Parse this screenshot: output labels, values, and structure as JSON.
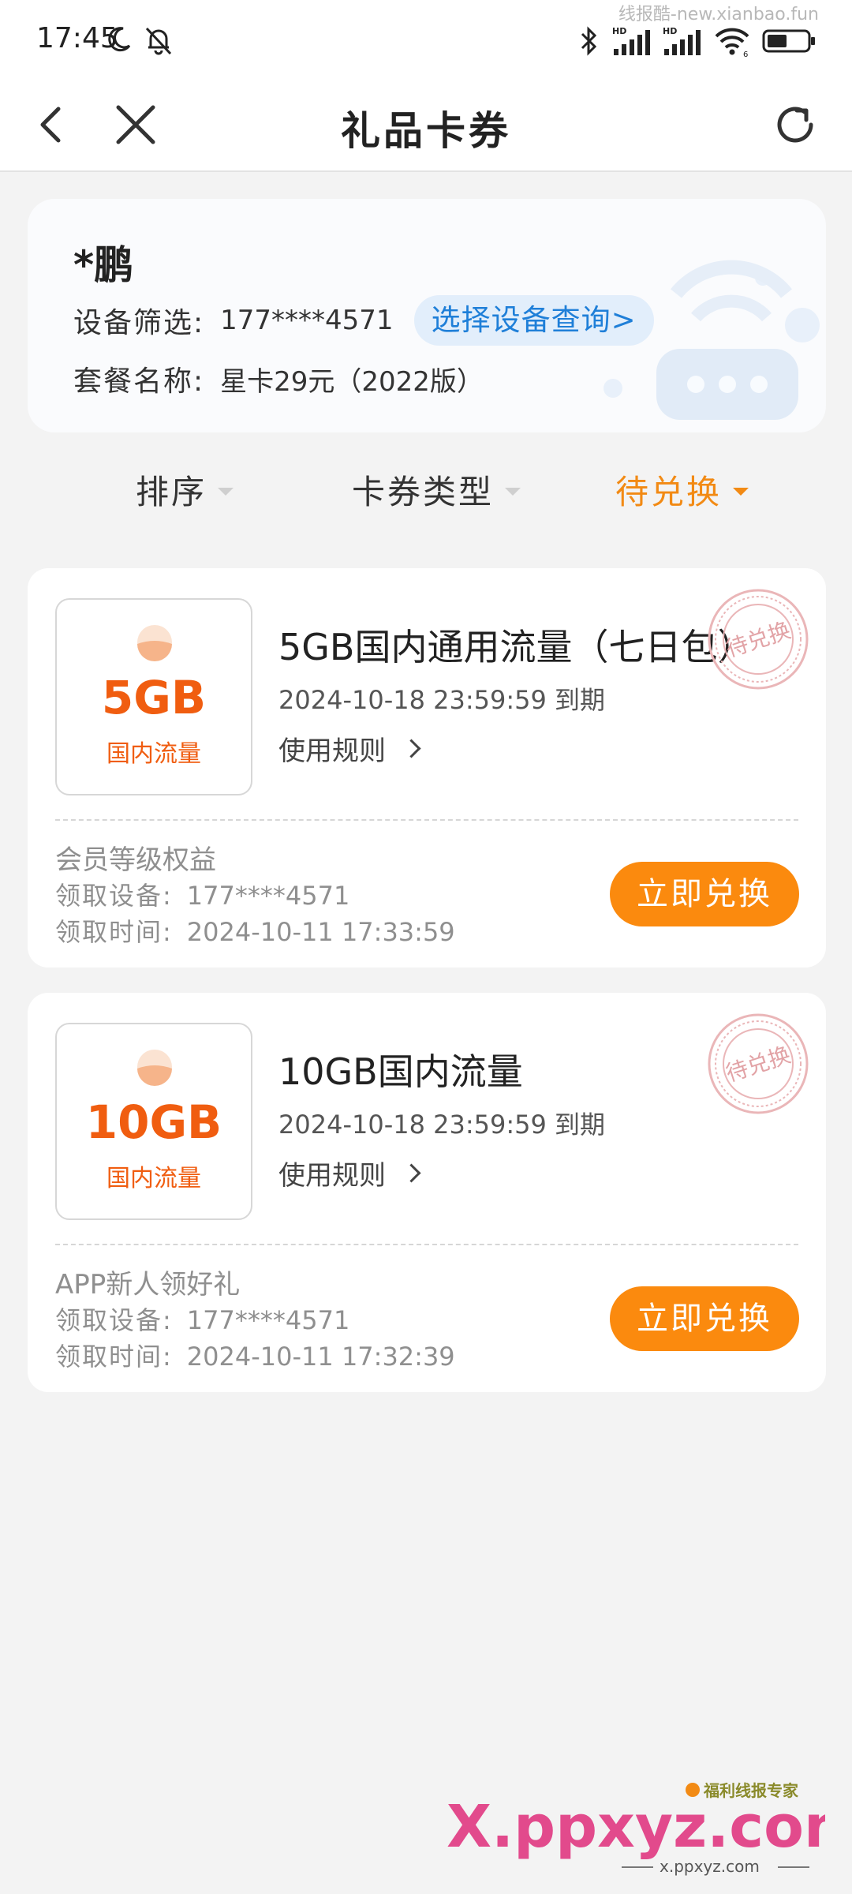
{
  "status_bar": {
    "time": "17:45",
    "watermark": "线报酷-new.xianbao.fun",
    "network_labels": [
      "HD",
      "HD"
    ],
    "wifi_badge": "6"
  },
  "nav": {
    "title": "礼品卡券"
  },
  "device_card": {
    "user_name": "*鹏",
    "device_label": "设备筛选:",
    "device_value": "177****4571",
    "select_button": "选择设备查询>",
    "plan_label": "套餐名称:",
    "plan_value": "星卡29元（2022版）"
  },
  "filters": [
    {
      "label": "排序",
      "active": false
    },
    {
      "label": "卡券类型",
      "active": false
    },
    {
      "label": "待兑换",
      "active": true
    }
  ],
  "coupons": [
    {
      "thumb_amount": "5GB",
      "thumb_sub": "国内流量",
      "title": "5GB国内通用流量（七日包）",
      "expire": "2024-10-18 23:59:59 到期",
      "rules": "使用规则",
      "stamp": "待兑换",
      "source": "会员等级权益",
      "device_key": "领取设备:",
      "device_value": "177****4571",
      "time_key": "领取时间:",
      "time_value": "2024-10-11 17:33:59",
      "button": "立即兑换"
    },
    {
      "thumb_amount": "10GB",
      "thumb_sub": "国内流量",
      "title": "10GB国内流量",
      "expire": "2024-10-18 23:59:59 到期",
      "rules": "使用规则",
      "stamp": "待兑换",
      "source": "APP新人领好礼",
      "device_key": "领取设备:",
      "device_value": "177****4571",
      "time_key": "领取时间:",
      "time_value": "2024-10-11 17:32:39",
      "button": "立即兑换"
    }
  ],
  "watermark_bottom": {
    "logo_text": "X.ppxyz.com",
    "tag": "福利线报专家",
    "url": "x.ppxyz.com"
  },
  "colors": {
    "accent_orange": "#fb8a0e",
    "thumb_orange": "#f05d10",
    "link_blue": "#1f7fd8",
    "stamp_red": "#e2a3a6"
  }
}
